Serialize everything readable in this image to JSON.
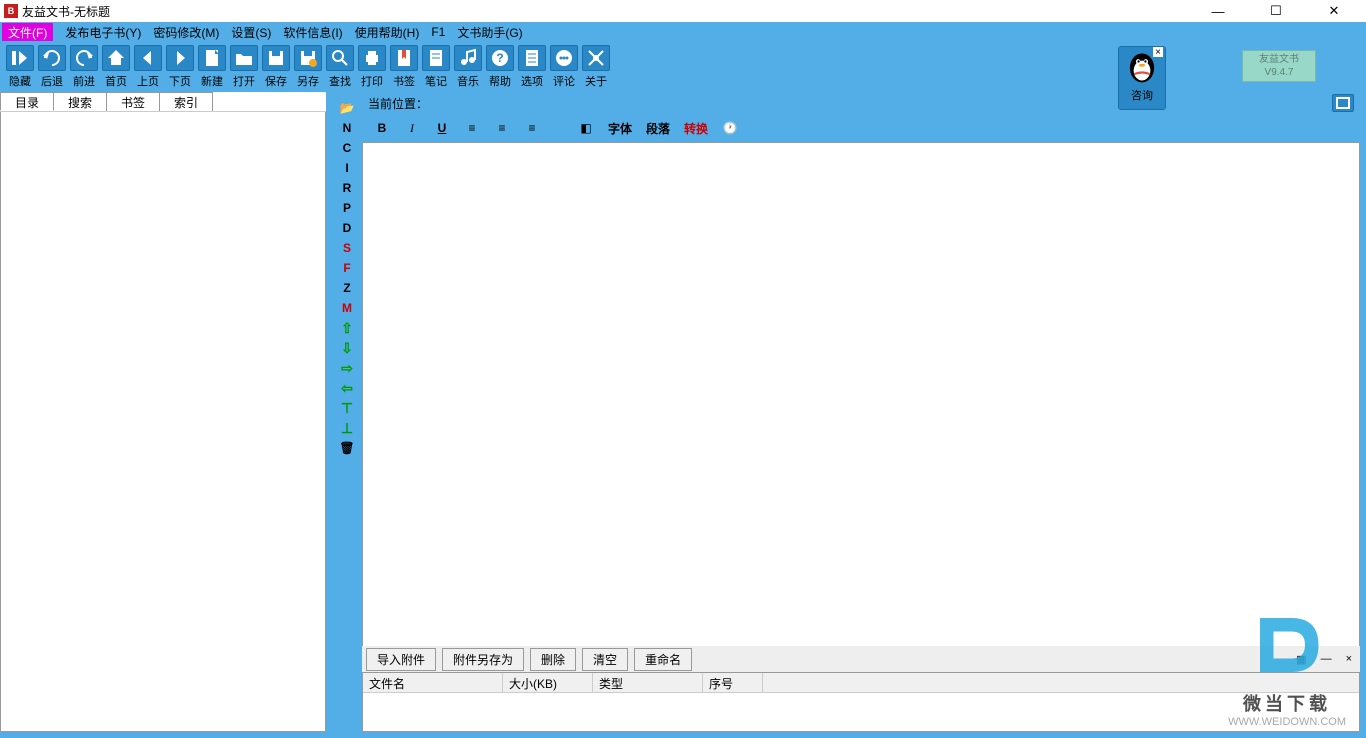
{
  "window": {
    "title": "友益文书-无标题"
  },
  "menu": {
    "first": "文件(F)",
    "items": [
      "发布电子书(Y)",
      "密码修改(M)",
      "设置(S)",
      "软件信息(I)",
      "使用帮助(H)",
      "F1",
      "文书助手(G)"
    ]
  },
  "toolbar": [
    {
      "label": "隐藏",
      "icon": "hide"
    },
    {
      "label": "后退",
      "icon": "back"
    },
    {
      "label": "前进",
      "icon": "forward"
    },
    {
      "label": "首页",
      "icon": "home"
    },
    {
      "label": "上页",
      "icon": "prev"
    },
    {
      "label": "下页",
      "icon": "next"
    },
    {
      "label": "新建",
      "icon": "new"
    },
    {
      "label": "打开",
      "icon": "open"
    },
    {
      "label": "保存",
      "icon": "save"
    },
    {
      "label": "另存",
      "icon": "saveas"
    },
    {
      "label": "查找",
      "icon": "find"
    },
    {
      "label": "打印",
      "icon": "print"
    },
    {
      "label": "书签",
      "icon": "bookmark"
    },
    {
      "label": "笔记",
      "icon": "note"
    },
    {
      "label": "音乐",
      "icon": "music"
    },
    {
      "label": "帮助",
      "icon": "help"
    },
    {
      "label": "选项",
      "icon": "options"
    },
    {
      "label": "评论",
      "icon": "comment"
    },
    {
      "label": "关于",
      "icon": "about"
    }
  ],
  "qq": {
    "label": "咨询"
  },
  "version": {
    "line1": "友益文书",
    "line2": "V9.4.7"
  },
  "leftTabs": [
    "目录",
    "搜索",
    "书签",
    "索引"
  ],
  "midButtons": [
    {
      "t": "📂",
      "cls": ""
    },
    {
      "t": "N",
      "cls": ""
    },
    {
      "t": "C",
      "cls": ""
    },
    {
      "t": "I",
      "cls": ""
    },
    {
      "t": "R",
      "cls": ""
    },
    {
      "t": "P",
      "cls": ""
    },
    {
      "t": "D",
      "cls": ""
    },
    {
      "t": "S",
      "cls": "red"
    },
    {
      "t": "F",
      "cls": "red"
    },
    {
      "t": "Z",
      "cls": ""
    },
    {
      "t": "M",
      "cls": "red"
    },
    {
      "t": "⇧",
      "cls": "arrow"
    },
    {
      "t": "⇩",
      "cls": "arrow"
    },
    {
      "t": "⇨",
      "cls": "arrow"
    },
    {
      "t": "⇦",
      "cls": "arrow"
    },
    {
      "t": "⊤",
      "cls": "arrow"
    },
    {
      "t": "⊥",
      "cls": "arrow"
    },
    {
      "t": "🗑",
      "cls": ""
    }
  ],
  "location": {
    "label": "当前位置："
  },
  "editor": {
    "bold": "B",
    "italic": "I",
    "underline": "U",
    "font": "字体",
    "para": "段落",
    "convert": "转换"
  },
  "attach": {
    "buttons": [
      "导入附件",
      "附件另存为",
      "删除",
      "清空",
      "重命名"
    ],
    "columns": [
      "文件名",
      "大小(KB)",
      "类型",
      "序号"
    ]
  },
  "watermark": {
    "t1": "微当下载",
    "t2": "WWW.WEIDOWN.COM"
  }
}
